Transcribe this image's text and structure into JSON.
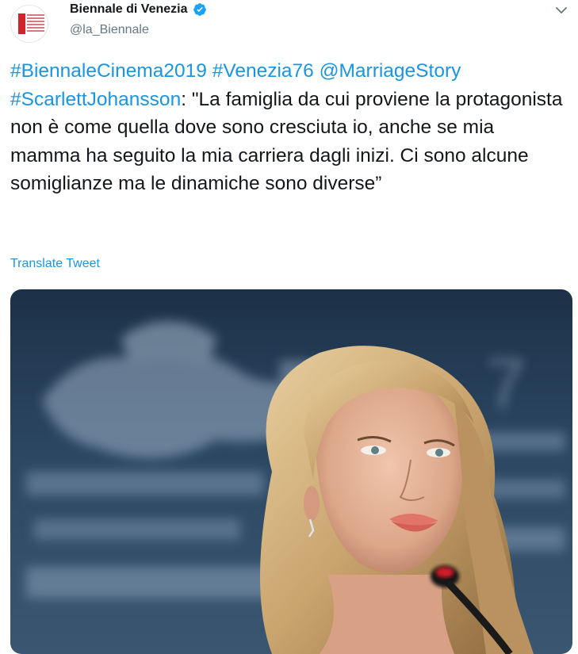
{
  "account": {
    "display_name": "Biennale di Venezia",
    "handle": "@la_Biennale",
    "verified": true,
    "avatar_icon": "biennale-logo-icon",
    "brand_color": "#d2232a"
  },
  "tweet": {
    "text_parts": {
      "hashtag1": "#BiennaleCinema2019",
      "hashtag2": "#Venezia76",
      "mention": "@MarriageStory",
      "hashtag3": "#ScarlettJohansson",
      "body": ": \"La famiglia da cui proviene la protagonista non è come quella dove sono cresciuta io, anche se mia mamma ha seguito la mia carriera dagli inizi. Ci sono alcune somiglianze ma le dinamiche sono diverse”"
    },
    "translate_label": "Translate Tweet",
    "link_color": "#1b95e0"
  },
  "media": {
    "icon": "press-conference-photo"
  }
}
